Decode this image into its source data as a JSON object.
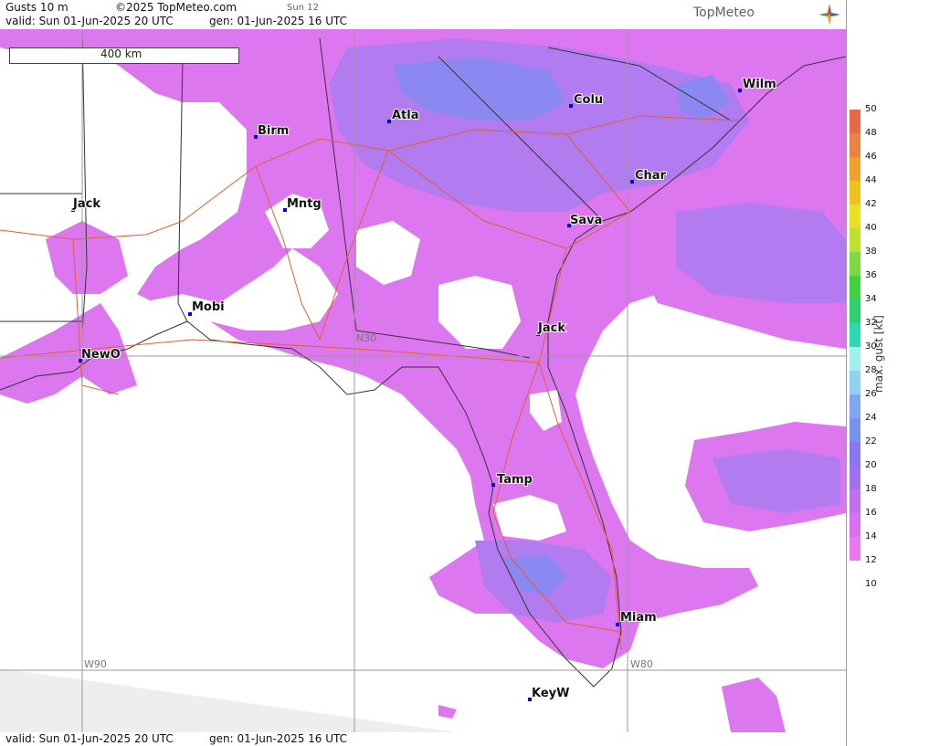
{
  "header": {
    "product": "Gusts 10 m",
    "copyright": "©2025 TopMeteo.com",
    "run": "Sun 12",
    "valid": "valid:  Sun  01-Jun-2025  20 UTC",
    "gen": "gen: 01-Jun-2025 16 UTC",
    "logo": "TopMeteo"
  },
  "footer": {
    "valid": "valid:  Sun  01-Jun-2025  20 UTC",
    "gen": "gen: 01-Jun-2025 16 UTC"
  },
  "scale": {
    "label": "400 km"
  },
  "grid_labels": {
    "w90": "W90",
    "w80": "W80",
    "n30": "N30"
  },
  "cities": {
    "wilm": "Wilm",
    "colu": "Colu",
    "atla": "Atla",
    "birm": "Birm",
    "char": "Char",
    "jack_ms": "Jack",
    "mntg": "Mntg",
    "sava": "Sava",
    "mobi": "Mobi",
    "jack_fl": "Jack",
    "newo": "NewO",
    "tamp": "Tamp",
    "miam": "Miam",
    "keyw": "KeyW"
  },
  "legend": {
    "title": "max. gust [kt]",
    "ticks": [
      50,
      48,
      46,
      44,
      42,
      40,
      38,
      36,
      34,
      32,
      30,
      28,
      26,
      24,
      22,
      20,
      18,
      16,
      14,
      12,
      10
    ],
    "colors": {
      "50": "#e05050",
      "48": "#e86848",
      "46": "#ee8040",
      "44": "#f0a030",
      "42": "#f0c020",
      "40": "#e8e020",
      "38": "#c0e030",
      "36": "#80d840",
      "34": "#40d040",
      "32": "#30d070",
      "30": "#30d8b0",
      "28": "#a0f0f0",
      "26": "#90d0f0",
      "24": "#80a8f0",
      "22": "#7890f0",
      "20": "#8878f0",
      "18": "#a070f0",
      "16": "#c070f0",
      "14": "#d870f0",
      "12": "#e878f0"
    }
  },
  "colors": {
    "gust_low": "#dd77f0",
    "gust_mid": "#b37bf0",
    "gust_high": "#8c88f2",
    "road": "#e06030",
    "border": "#333333"
  }
}
